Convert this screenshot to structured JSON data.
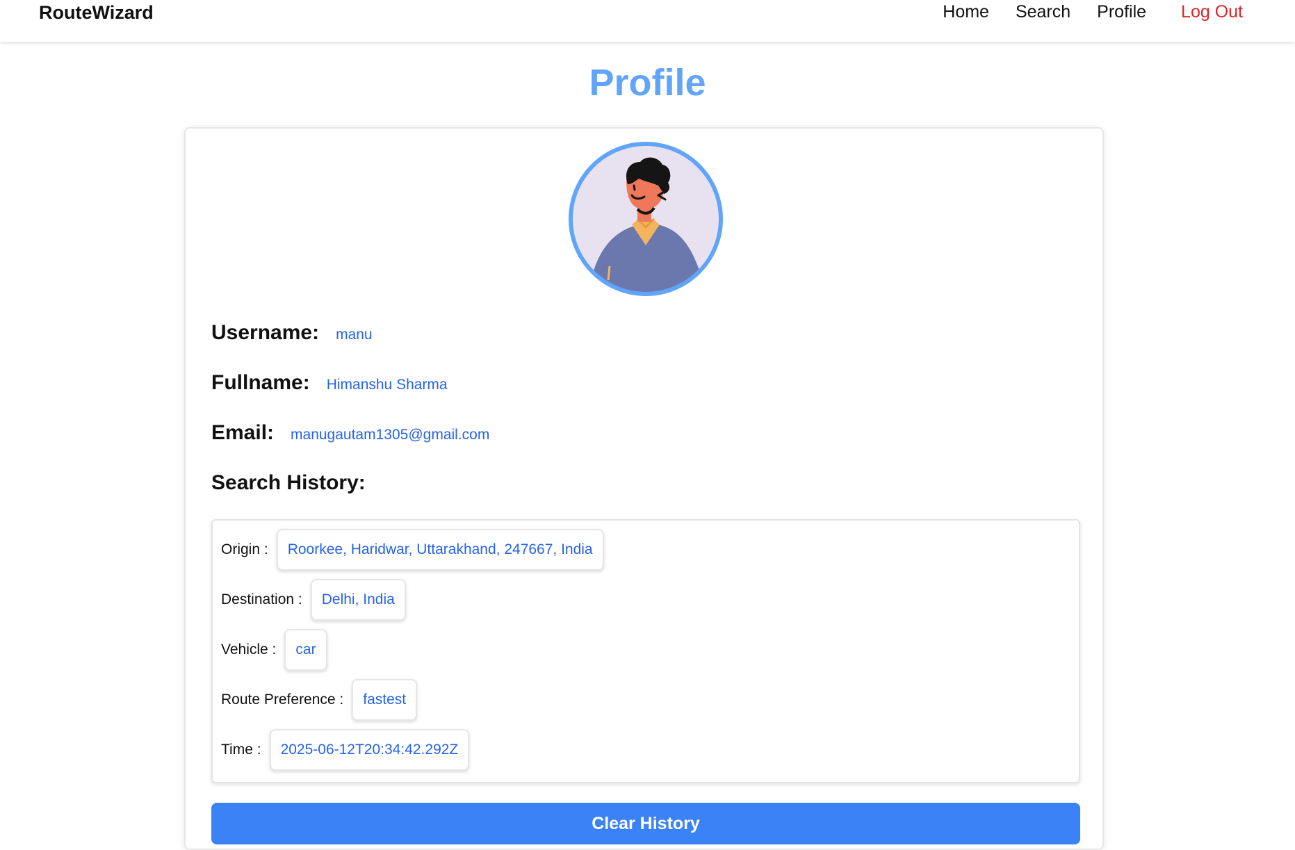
{
  "nav": {
    "brand": "RouteWizard",
    "links": [
      "Home",
      "Search",
      "Profile"
    ],
    "logout": "Log Out"
  },
  "page": {
    "title": "Profile"
  },
  "avatar": {
    "icon": "user-avatar-illustration",
    "ring_color": "#60a5fa"
  },
  "profile": {
    "username_label": "Username:",
    "username": "manu",
    "fullname_label": "Fullname:",
    "fullname": "Himanshu Sharma",
    "email_label": "Email:",
    "email": "manugautam1305@gmail.com"
  },
  "history": {
    "title": "Search History:",
    "entry": {
      "origin_label": "Origin :",
      "origin": "Roorkee, Haridwar, Uttarakhand, 247667, India",
      "destination_label": "Destination :",
      "destination": "Delhi, India",
      "vehicle_label": "Vehicle :",
      "vehicle": "car",
      "preference_label": "Route Preference :",
      "preference": "fastest",
      "time_label": "Time :",
      "time": "2025-06-12T20:34:42.292Z"
    }
  },
  "actions": {
    "clear_label": "Clear History"
  },
  "colors": {
    "accent": "#60a5fa",
    "link": "#2563eb",
    "button": "#3b82f6",
    "danger": "#dc2626"
  }
}
